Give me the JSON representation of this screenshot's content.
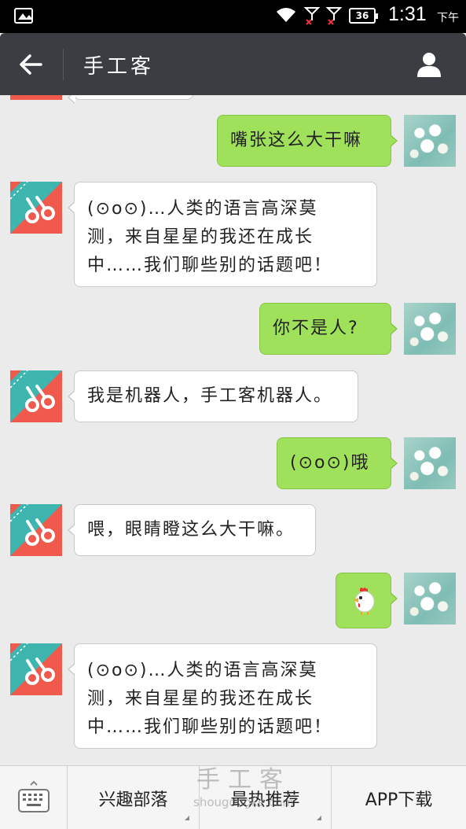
{
  "status_bar": {
    "battery": "36",
    "time": "1:31",
    "ampm": "下午"
  },
  "header": {
    "title": "手工客"
  },
  "messages": [
    {
      "side": "right",
      "text": "嘴张这么大干嘛"
    },
    {
      "side": "left",
      "lines": [
        "(⊙o⊙)…人类的语言高深莫",
        "测，来自星星的我还在成长",
        "中……我们聊些别的话题吧！"
      ]
    },
    {
      "side": "right",
      "text": "你不是人?"
    },
    {
      "side": "left",
      "text": "我是机器人，手工客机器人。"
    },
    {
      "side": "right",
      "text": "(⊙o⊙)哦"
    },
    {
      "side": "left",
      "text": "喂，眼睛瞪这么大干嘛。"
    },
    {
      "side": "right",
      "emoji": "chicken"
    },
    {
      "side": "left",
      "lines": [
        "(⊙o⊙)…人类的语言高深莫",
        "测，来自星星的我还在成长",
        "中……我们聊些别的话题吧！"
      ]
    }
  ],
  "bottom_menu": {
    "items": [
      "兴趣部落",
      "最热推荐",
      "APP下载"
    ]
  },
  "watermark": {
    "top": "手工客",
    "bottom": "shougongke.com"
  },
  "colors": {
    "title_bar": "#3a3d42",
    "sent_bubble": "#9fe15a",
    "received_bubble": "#ffffff",
    "avatar_bot": "#ef5a4c"
  }
}
